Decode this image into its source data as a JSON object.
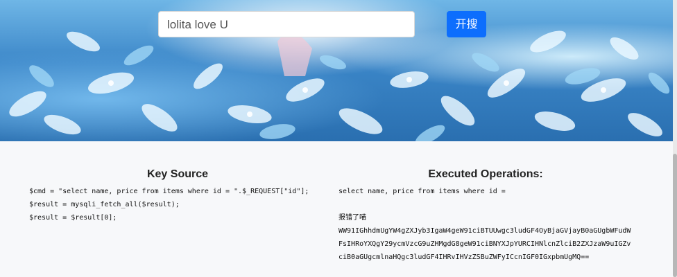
{
  "search": {
    "value": "lolita love U",
    "button_label": "开搜"
  },
  "key_source": {
    "title": "Key Source",
    "lines": [
      "$cmd = \"select name, price from items where id = \".$_REQUEST[\"id\"];",
      "$result = mysqli_fetch_all($result);",
      "$result = $result[0];"
    ]
  },
  "executed": {
    "title": "Executed Operations:",
    "query": "select name, price from items where id =",
    "error_label": "报错了喵",
    "encoded": "WW91IGhhdmUgYW4gZXJyb3IgaW4geW91ciBTUUwgc3ludGF4OyBjaGVjayB0aGUgbWFudWFsIHRoYXQgY29ycmVzcG9uZHMgdG8geW91ciBNYXJpYURCIHNlcnZlciB2ZXJzaW9uIGZvciB0aGUgcmlnaHQgc3ludGF4IHRvIHVzZSBuZWFyICcnIGF0IGxpbmUgMQ=="
  },
  "colors": {
    "accent": "#0d6efd",
    "background": "#f7f8fa"
  }
}
